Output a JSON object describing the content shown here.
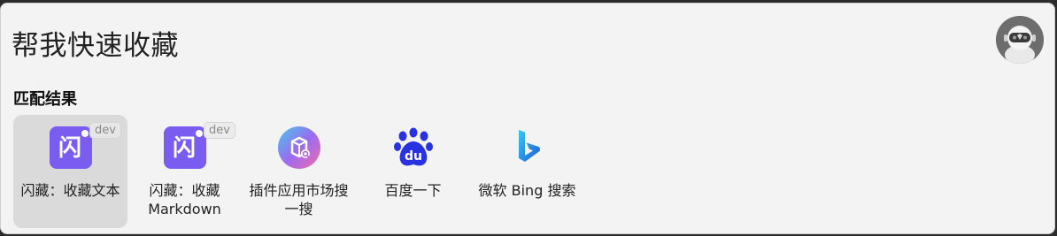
{
  "search": {
    "query": "帮我快速收藏"
  },
  "user": {
    "avatar_icon": "robot-avatar-icon"
  },
  "results": {
    "title": "匹配结果",
    "items": [
      {
        "label": "闪藏：收藏文本",
        "icon": "shancang-app-icon",
        "glyph": "闪",
        "badge": "dev",
        "selected": true
      },
      {
        "label": "闪藏：收藏Markdown",
        "icon": "shancang-app-icon",
        "glyph": "闪",
        "badge": "dev",
        "selected": false
      },
      {
        "label": "插件应用市场搜一搜",
        "icon": "plugin-market-search-icon",
        "selected": false
      },
      {
        "label": "百度一下",
        "icon": "baidu-paw-icon",
        "glyph": "du",
        "selected": false
      },
      {
        "label": "微软 Bing 搜索",
        "icon": "bing-logo-icon",
        "selected": false
      }
    ]
  },
  "colors": {
    "shancang_purple": "#7b5cf0",
    "baidu_blue": "#2932e1",
    "bing_blue": "#1a86d6",
    "selected_bg": "#dadada"
  }
}
